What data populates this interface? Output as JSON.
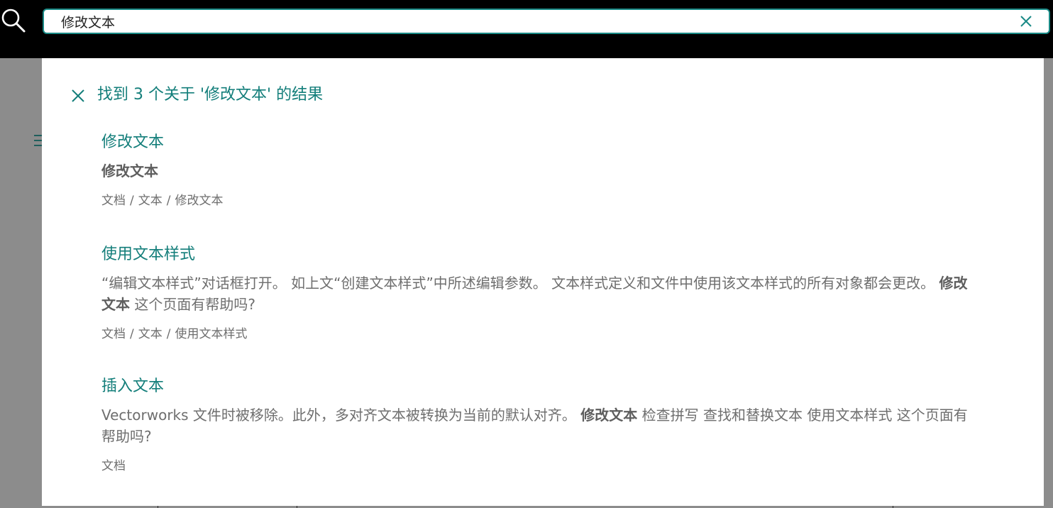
{
  "search": {
    "value": "修改文本",
    "icon": "search-icon",
    "clear_icon": "close-icon"
  },
  "results_panel": {
    "title": "找到 3 个关于 '修改文本' 的结果",
    "close_icon": "close-icon",
    "results": [
      {
        "title": "修改文本",
        "snippet_before": "",
        "snippet_bold": "修改文本",
        "snippet_after": "",
        "path": [
          "文档",
          "文本",
          "修改文本"
        ]
      },
      {
        "title": "使用文本样式",
        "snippet_before": "“编辑文本样式”对话框打开。 如上文“创建文本样式”中所述编辑参数。 文本样式定义和文件中使用该文本样式的所有对象都会更改。 ",
        "snippet_bold": "修改文本",
        "snippet_after": " 这个页面有帮助吗?",
        "path": [
          "文档",
          "文本",
          "使用文本样式"
        ]
      },
      {
        "title": "插入文本",
        "snippet_before": "Vectorworks 文件时被移除。此外，多对齐文本被转换为当前的默认对齐。 ",
        "snippet_bold": "修改文本",
        "snippet_after": " 检查拼写 查找和替换文本 使用文本样式 这个页面有帮助吗?",
        "path": [
          "文档"
        ]
      }
    ]
  },
  "colors": {
    "accent": "#137e7a",
    "text_muted": "#6e6e6e",
    "topbar": "#000000",
    "backdrop": "#8c8c8c"
  }
}
